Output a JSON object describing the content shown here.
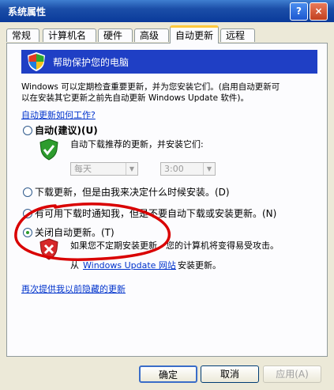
{
  "window": {
    "title": "系统属性",
    "help_label": "?",
    "close_label": "×"
  },
  "tabs": [
    {
      "label": "常规"
    },
    {
      "label": "计算机名"
    },
    {
      "label": "硬件"
    },
    {
      "label": "高级"
    },
    {
      "label": "自动更新"
    },
    {
      "label": "远程"
    }
  ],
  "banner": {
    "text": "帮助保护您的电脑"
  },
  "description": {
    "line1": "Windows 可以定期检查重要更新，并为您安装它们。(启用自动更新可",
    "line2": "以在安装其它更新之前先自动更新 Windows Update 软件)。"
  },
  "how_link": "自动更新如何工作?",
  "options": {
    "auto": {
      "label": "自动(建议)(U)",
      "desc": "自动下载推荐的更新，并安装它们:"
    },
    "day_select": "每天",
    "time_select": "3:00",
    "download": {
      "label": "下载更新，但是由我来决定什么时候安装。(D)"
    },
    "notify": {
      "label": "有可用下载时通知我，但是不要自动下载或安装更新。(N)"
    },
    "off": {
      "label": "关闭自动更新。(T)",
      "desc": "如果您不定期安装更新，您的计算机将变得易受攻击。",
      "from_prefix": "从",
      "site_link": "Windows Update 网站",
      "from_suffix": "安装更新。"
    }
  },
  "redisplay_link": "再次提供我以前隐藏的更新",
  "buttons": {
    "ok": "确定",
    "cancel": "取消",
    "apply": "应用(A)"
  },
  "colors": {
    "banner": "#1f3fc5",
    "title_bar": "#0a3a9a",
    "link": "#0033cc",
    "annotation": "#d90000"
  }
}
